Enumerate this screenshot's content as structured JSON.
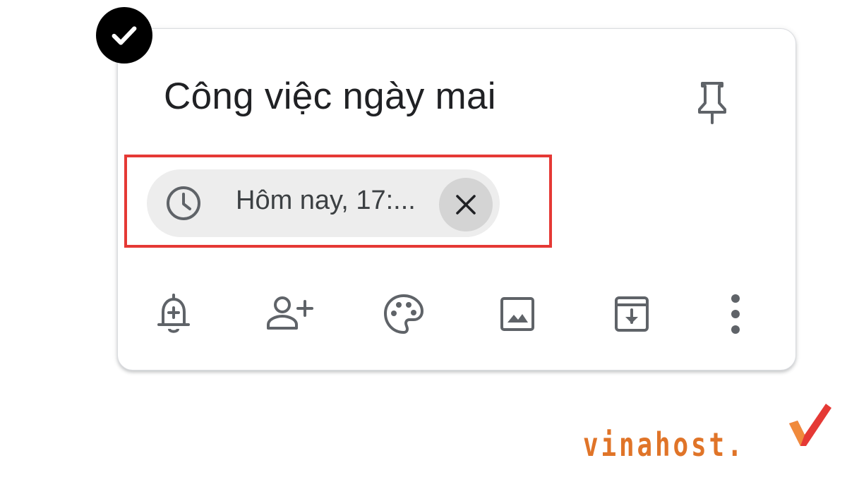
{
  "note": {
    "title": "Công việc ngày mai",
    "reminder_chip": {
      "label": "Hôm nay, 17:..."
    }
  },
  "icons": {
    "check_badge": "check-circle-icon",
    "pin": "pin-icon",
    "clock": "clock-icon",
    "remove": "close-icon",
    "toolbar": [
      "remind-me-icon",
      "collaborator-icon",
      "palette-icon",
      "image-icon",
      "archive-icon",
      "more-vert-icon"
    ]
  },
  "colors": {
    "highlight": "#e53935",
    "chip_background": "#ededed",
    "watermark": "#e07428"
  },
  "watermark": {
    "text": "vinahost."
  }
}
